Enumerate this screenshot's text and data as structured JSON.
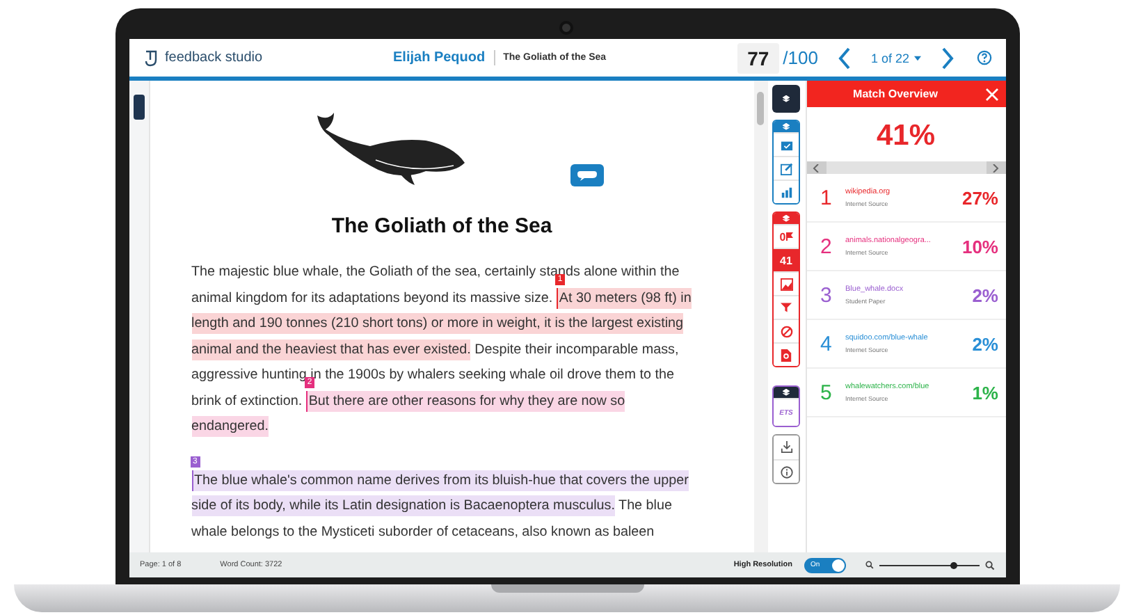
{
  "header": {
    "app_name": "feedback studio",
    "student": "Elijah Pequod",
    "paper_title": "The Goliath of the Sea",
    "score": "77",
    "score_max": "/100",
    "pager": "1 of 22"
  },
  "document": {
    "title": "The Goliath of the Sea",
    "paragraphs": [
      {
        "segments": [
          {
            "kind": "plain",
            "text": "The majestic blue whale, the Goliath of the sea, certainly stands alone within the animal kingdom for its adaptations beyond its massive size. "
          },
          {
            "kind": "match",
            "marker": "1",
            "color": "#e8272b",
            "text": "At 30 meters (98 ft) in length and 190 tonnes (210 short tons) or more in weight, it is the largest existing animal and the heaviest that has ever existed."
          },
          {
            "kind": "plain",
            "text": " Despite their incomparable mass, aggressive hunting in the 1900s by whalers seeking whale oil drove them to the brink of extinction. "
          },
          {
            "kind": "match",
            "marker": "2",
            "color": "#e5307e",
            "text": "But there are other reasons for why they are now so endangered."
          }
        ]
      },
      {
        "segments": [
          {
            "kind": "match",
            "marker": "3",
            "color": "#9a5fd0",
            "text": "The blue whale's common name derives from its bluish-hue that covers the upper side of its body, while its Latin designation is Bacaenoptera musculus."
          },
          {
            "kind": "plain",
            "text": " The blue whale belongs to the Mysticeti suborder of cetaceans, also known as baleen"
          }
        ]
      }
    ]
  },
  "tools": {
    "flag_count": "0",
    "match_count": "41",
    "logo": "ETS"
  },
  "panel": {
    "title": "Match Overview",
    "overall": "41%",
    "matches": [
      {
        "number": "1",
        "source": "wikipedia.org",
        "type": "Internet Source",
        "percent": "27%",
        "color": "#e8272b"
      },
      {
        "number": "2",
        "source": "animals.nationalgeogra...",
        "type": "Internet Source",
        "percent": "10%",
        "color": "#e5307e"
      },
      {
        "number": "3",
        "source": "Blue_whale.docx",
        "type": "Student Paper",
        "percent": "2%",
        "color": "#9a5fd0"
      },
      {
        "number": "4",
        "source": "squidoo.com/blue-whale",
        "type": "Internet Source",
        "percent": "2%",
        "color": "#2a8fd6"
      },
      {
        "number": "5",
        "source": "whalewatchers.com/blue",
        "type": "Internet Source",
        "percent": "1%",
        "color": "#2db34a"
      }
    ]
  },
  "footer": {
    "page": "Page: 1 of 8",
    "word_count": "Word Count: 3722",
    "resolution_label": "High Resolution",
    "toggle": {
      "label": "On",
      "on": true
    },
    "zoom": {
      "level": 0.75
    }
  }
}
